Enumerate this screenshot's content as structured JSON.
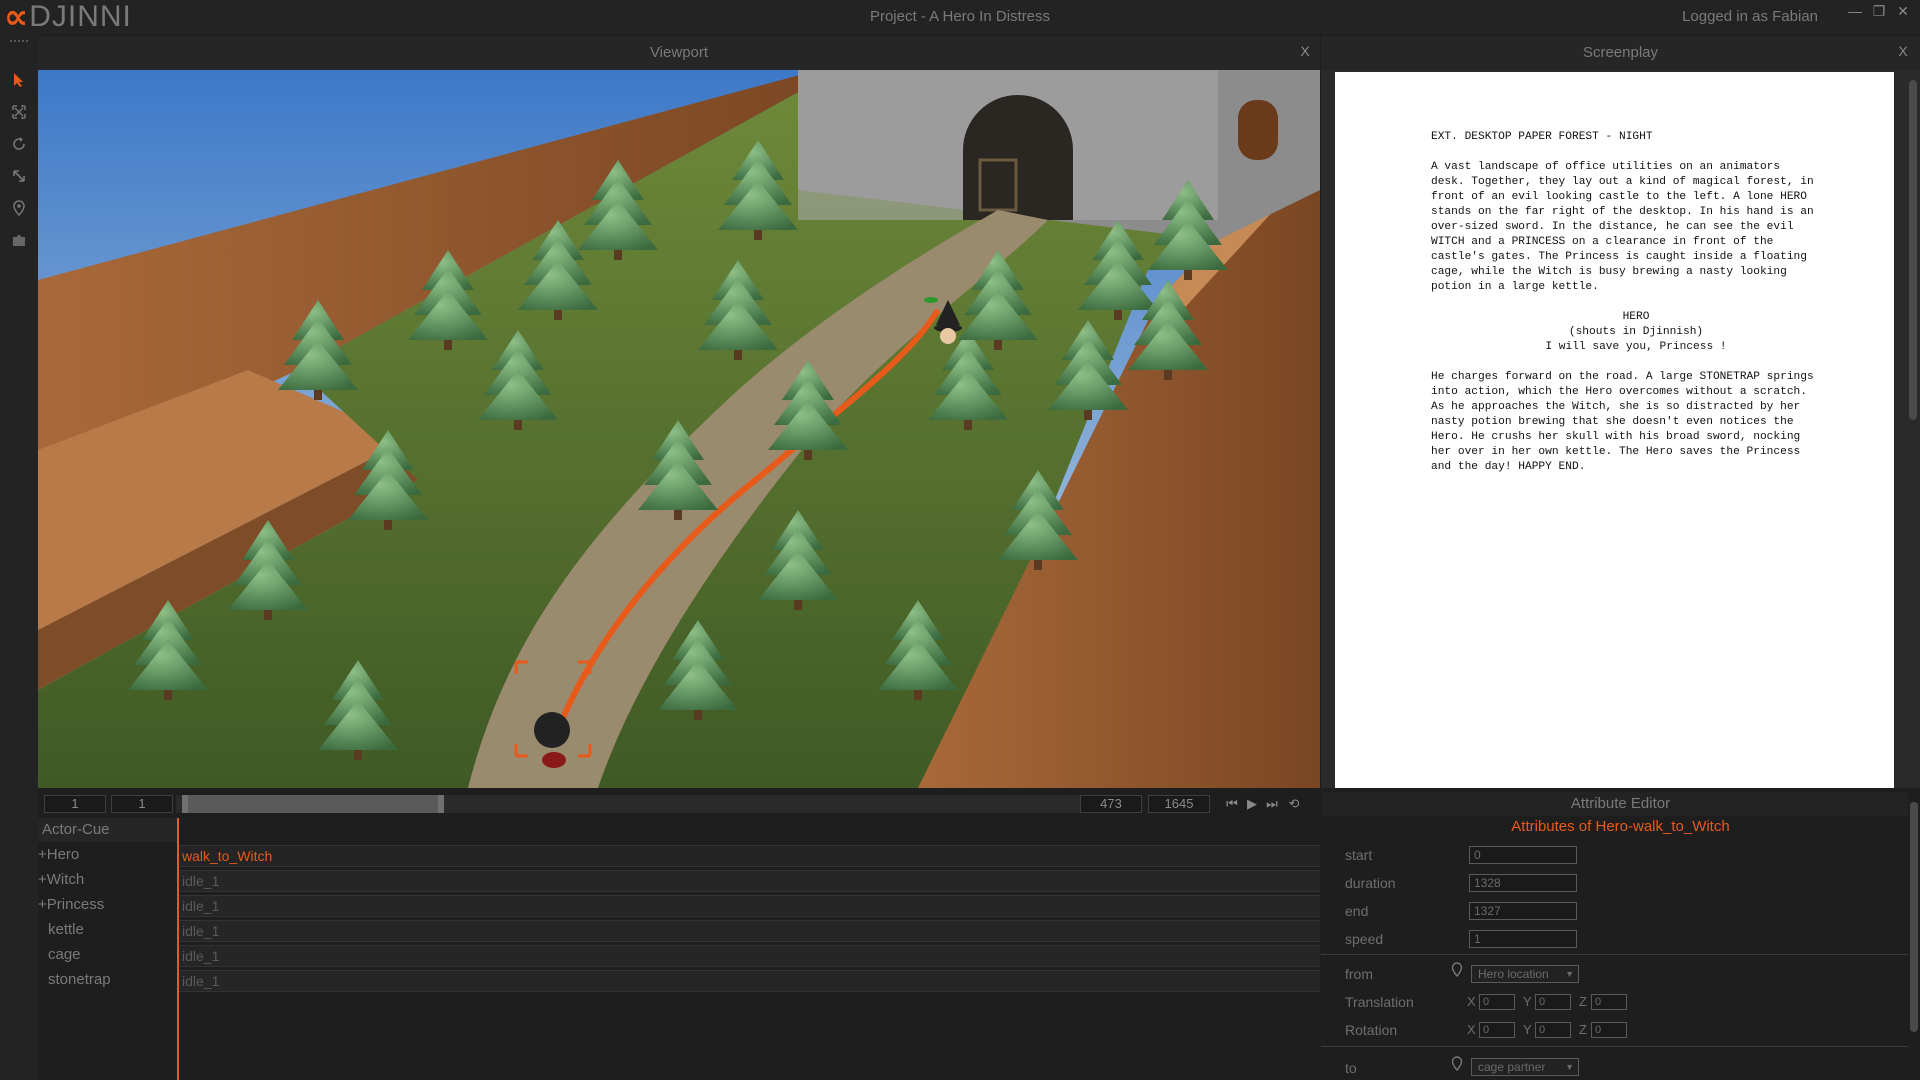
{
  "app": {
    "logo_mark": "∝",
    "logo_word": "DJINNI",
    "title": "Project - A Hero In Distress",
    "login": "Logged in as Fabian"
  },
  "window_controls": {
    "minimize": "—",
    "maximize": "❐",
    "close": "✕"
  },
  "tools": [
    "select-arrow-icon",
    "move-icon",
    "rotate-icon",
    "scale-icon",
    "location-pin-icon",
    "puzzle-icon"
  ],
  "viewport": {
    "title": "Viewport",
    "close": "X"
  },
  "screenplay": {
    "title": "Screenplay",
    "close": "X",
    "heading": "EXT. DESKTOP PAPER FOREST - NIGHT",
    "paragraph1": "A vast landscape of office utilities on an animators\ndesk. Together, they lay out a kind of magical forest, in\nfront of an evil looking castle to the left. A lone HERO\nstands on the far right of the desktop. In his hand is an\nover-sized sword. In the distance, he can see the evil\nWITCH and a PRINCESS on a clearance in front of the\ncastle's gates. The Princess is caught inside a floating\ncage, while the Witch is busy brewing a nasty looking\npotion in a large kettle.",
    "character": "HERO",
    "parenthetical": "(shouts in Djinnish)",
    "dialogue": "I will save you, Princess !",
    "paragraph2": "He charges forward on the road. A large STONETRAP springs\ninto action, which the Hero overcomes without a scratch.\nAs he approaches the Witch, she is so distracted by her\nnasty potion brewing that she doesn't even notices the\nHero. He crushs her skull with his broad sword, nocking\nher over in her own kettle. The Hero saves the Princess\nand the day! HAPPY END."
  },
  "timeline": {
    "start_field": "1",
    "second_field": "1",
    "current_frame": "473",
    "end_frame": "1645",
    "controls": {
      "skip_back": "⏮",
      "play": "▶",
      "skip_forward": "⏭",
      "loop": "⟲"
    },
    "range_selected_fraction": [
      0.0,
      0.28
    ]
  },
  "actor_cue": {
    "header": "Actor-Cue",
    "rows": [
      {
        "name": "+Hero",
        "cue": "walk_to_Witch",
        "active": true
      },
      {
        "name": "+Witch",
        "cue": "idle_1",
        "active": false
      },
      {
        "name": "+Princess",
        "cue": "idle_1",
        "active": false
      },
      {
        "name": "kettle",
        "cue": "idle_1",
        "active": false
      },
      {
        "name": "cage",
        "cue": "idle_1",
        "active": false
      },
      {
        "name": "stonetrap",
        "cue": "idle_1",
        "active": false
      }
    ]
  },
  "attribute_editor": {
    "title": "Attribute Editor",
    "subtitle": "Attributes of Hero-walk_to_Witch",
    "start_label": "start",
    "start_value": "0",
    "duration_label": "duration",
    "duration_value": "1328",
    "end_label": "end",
    "end_value": "1327",
    "speed_label": "speed",
    "speed_value": "1",
    "from_label": "from",
    "from_value": "Hero location",
    "translation_label": "Translation",
    "rotation_label": "Rotation",
    "axis_x": "X",
    "axis_y": "Y",
    "axis_z": "Z",
    "translation": {
      "x": "0",
      "y": "0",
      "z": "0"
    },
    "rotation": {
      "x": "0",
      "y": "0",
      "z": "0"
    },
    "to_label": "to",
    "to_value": "cage partner"
  },
  "colors": {
    "accent": "#e85a1a",
    "background": "#1e1e1e",
    "panel": "#262626"
  }
}
